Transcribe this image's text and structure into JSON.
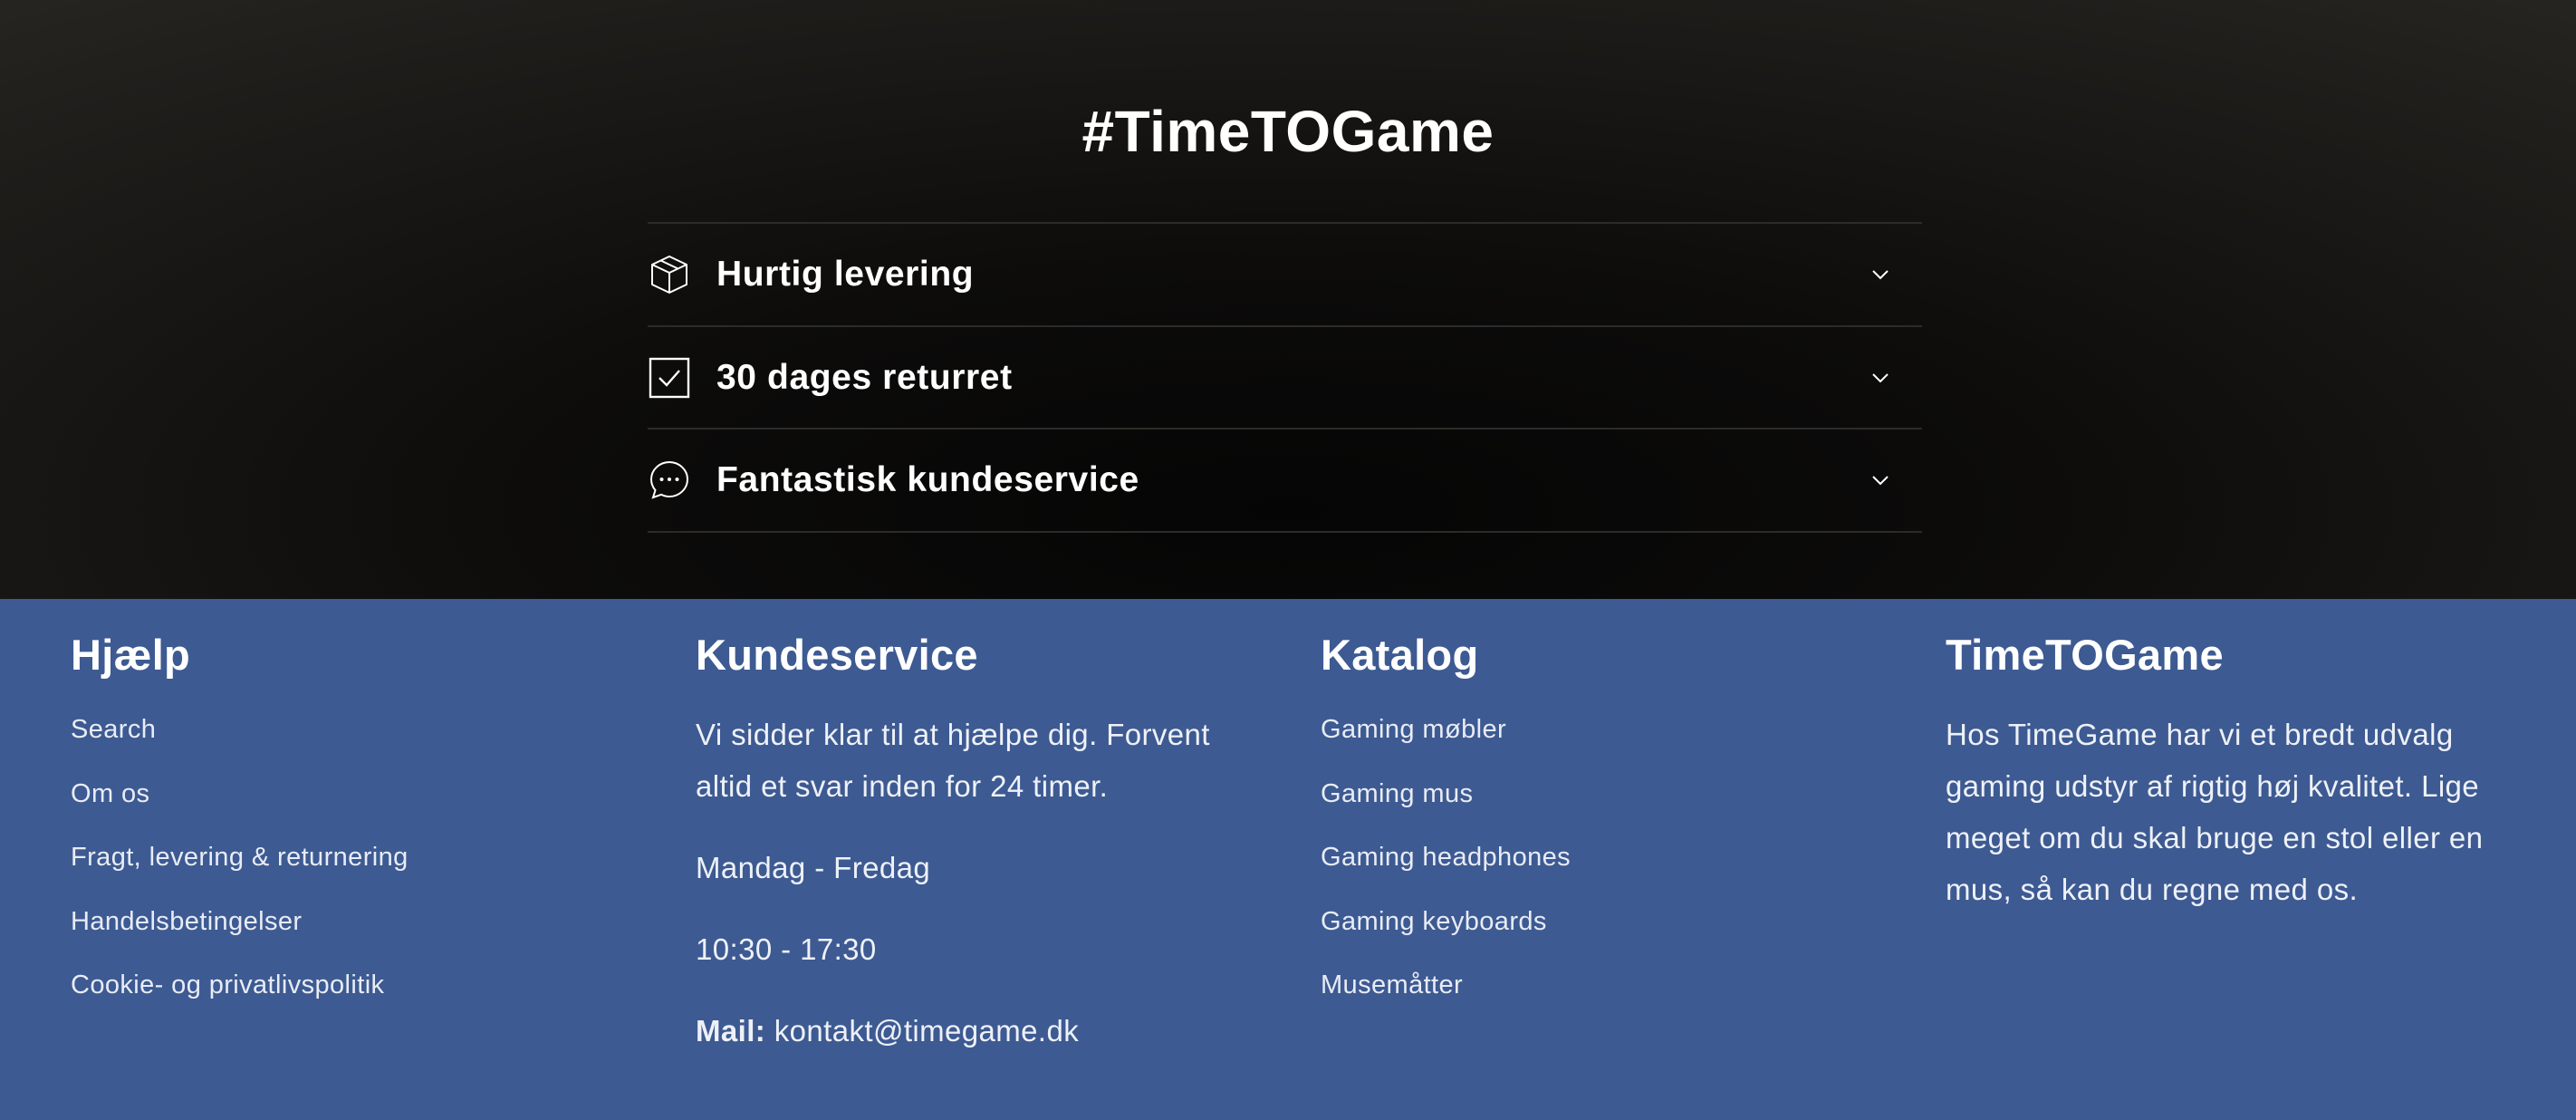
{
  "hero": {
    "title": "#TimeTOGame",
    "items": [
      {
        "icon": "box-icon",
        "label": "Hurtig levering"
      },
      {
        "icon": "checkbox-icon",
        "label": "30 dages returret"
      },
      {
        "icon": "chat-icon",
        "label": "Fantastisk kundeservice"
      }
    ]
  },
  "footer": {
    "help": {
      "heading": "Hjælp",
      "links": [
        "Search",
        "Om os",
        "Fragt, levering & returnering",
        "Handelsbetingelser",
        "Cookie- og privatlivspolitik"
      ]
    },
    "customer_service": {
      "heading": "Kundeservice",
      "text": "Vi sidder klar til at hjælpe dig. Forvent altid et svar inden for 24 timer.",
      "days": "Mandag - Fredag",
      "hours": "10:30 - 17:30",
      "mail_label": "Mail:",
      "mail_value": "kontakt@timegame.dk"
    },
    "catalog": {
      "heading": "Katalog",
      "links": [
        "Gaming møbler",
        "Gaming mus",
        "Gaming headphones",
        "Gaming keyboards",
        "Musemåtter"
      ]
    },
    "about": {
      "heading": "TimeTOGame",
      "text": "Hos TimeGame har vi et bredt udvalg gaming udstyr af rigtig høj kvalitet. Lige meget om du skal bruge en stol eller en mus, så kan du regne med os."
    }
  },
  "colors": {
    "footer_bg": "#3d5a92",
    "hero_bg": "#0a0908",
    "text": "#ffffff"
  }
}
